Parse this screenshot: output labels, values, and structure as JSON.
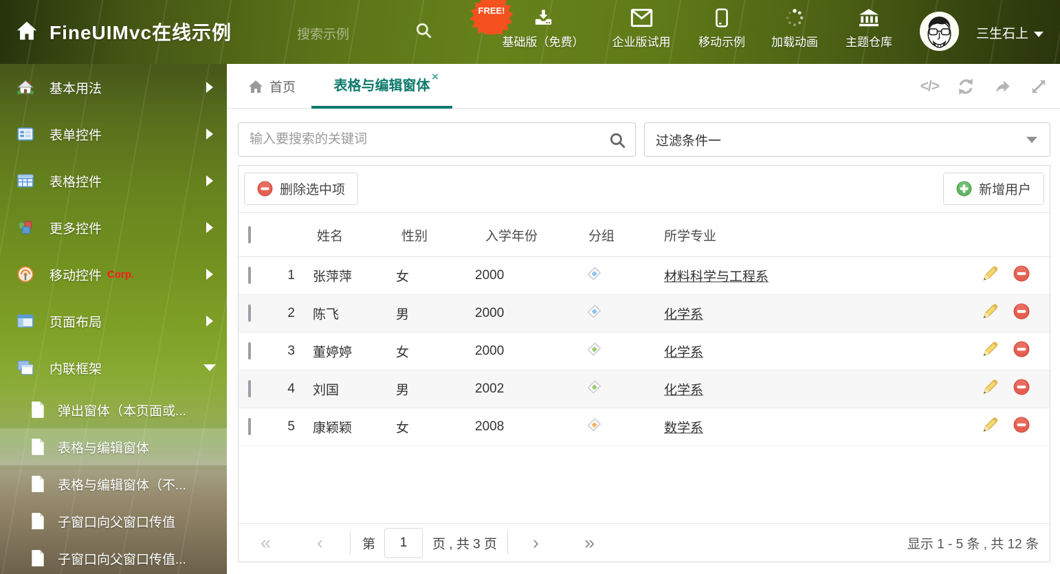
{
  "header": {
    "home_title": "FineUIMvc在线示例",
    "search_placeholder": "搜索示例",
    "free_badge": "FREE!",
    "nav_items": [
      {
        "label": "基础版（免费）",
        "icon": "download-icon"
      },
      {
        "label": "企业版试用",
        "icon": "envelope-icon"
      },
      {
        "label": "移动示例",
        "icon": "mobile-icon"
      },
      {
        "label": "加载动画",
        "icon": "spinner-icon"
      },
      {
        "label": "主题仓库",
        "icon": "bank-icon"
      }
    ],
    "username": "三生石上"
  },
  "sidebar": {
    "items": [
      {
        "label": "基本用法"
      },
      {
        "label": "表单控件"
      },
      {
        "label": "表格控件"
      },
      {
        "label": "更多控件"
      },
      {
        "label": "移动控件",
        "badge": "Corp."
      },
      {
        "label": "页面布局"
      },
      {
        "label": "内联框架"
      }
    ],
    "subitems": [
      {
        "label": "弹出窗体（本页面或..."
      },
      {
        "label": "表格与编辑窗体"
      },
      {
        "label": "表格与编辑窗体（不..."
      },
      {
        "label": "子窗口向父窗口传值"
      },
      {
        "label": "子窗口向父窗口传值..."
      }
    ]
  },
  "tabbar": {
    "home_tab": "首页",
    "active_tab": "表格与编辑窗体",
    "close_glyph": "×",
    "code_icon_text": "</>"
  },
  "filters": {
    "search_placeholder": "输入要搜索的关键词",
    "filter_selected": "过滤条件一"
  },
  "grid": {
    "delete_button": "删除选中项",
    "add_button": "新增用户",
    "columns": {
      "name": "姓名",
      "gender": "性别",
      "year": "入学年份",
      "group": "分组",
      "major": "所学专业"
    },
    "rows": [
      {
        "num": "1",
        "name": "张萍萍",
        "gender": "女",
        "year": "2000",
        "tag_color": "#86c5f4",
        "major": "材料科学与工程系"
      },
      {
        "num": "2",
        "name": "陈飞",
        "gender": "男",
        "year": "2000",
        "tag_color": "#86c5f4",
        "major": "化学系"
      },
      {
        "num": "3",
        "name": "董婷婷",
        "gender": "女",
        "year": "2000",
        "tag_color": "#9fc972",
        "major": "化学系"
      },
      {
        "num": "4",
        "name": "刘国",
        "gender": "男",
        "year": "2002",
        "tag_color": "#9fc972",
        "major": "化学系"
      },
      {
        "num": "5",
        "name": "康颖颖",
        "gender": "女",
        "year": "2008",
        "tag_color": "#f8b26a",
        "major": "数学系"
      }
    ]
  },
  "pagination": {
    "first_icon": "«",
    "prev_icon": "‹",
    "next_icon": "›",
    "last_icon": "»",
    "page_prefix": "第",
    "page_value": "1",
    "page_suffix": "页 , 共 3 页",
    "summary": "显示 1 - 5 条 , 共 12 条"
  },
  "colors": {
    "accent": "#0e7a6b",
    "free_badge": "#f4511e",
    "corp_red": "#ff1a1a",
    "delete_red": "#e55f50",
    "add_green": "#62b462"
  }
}
